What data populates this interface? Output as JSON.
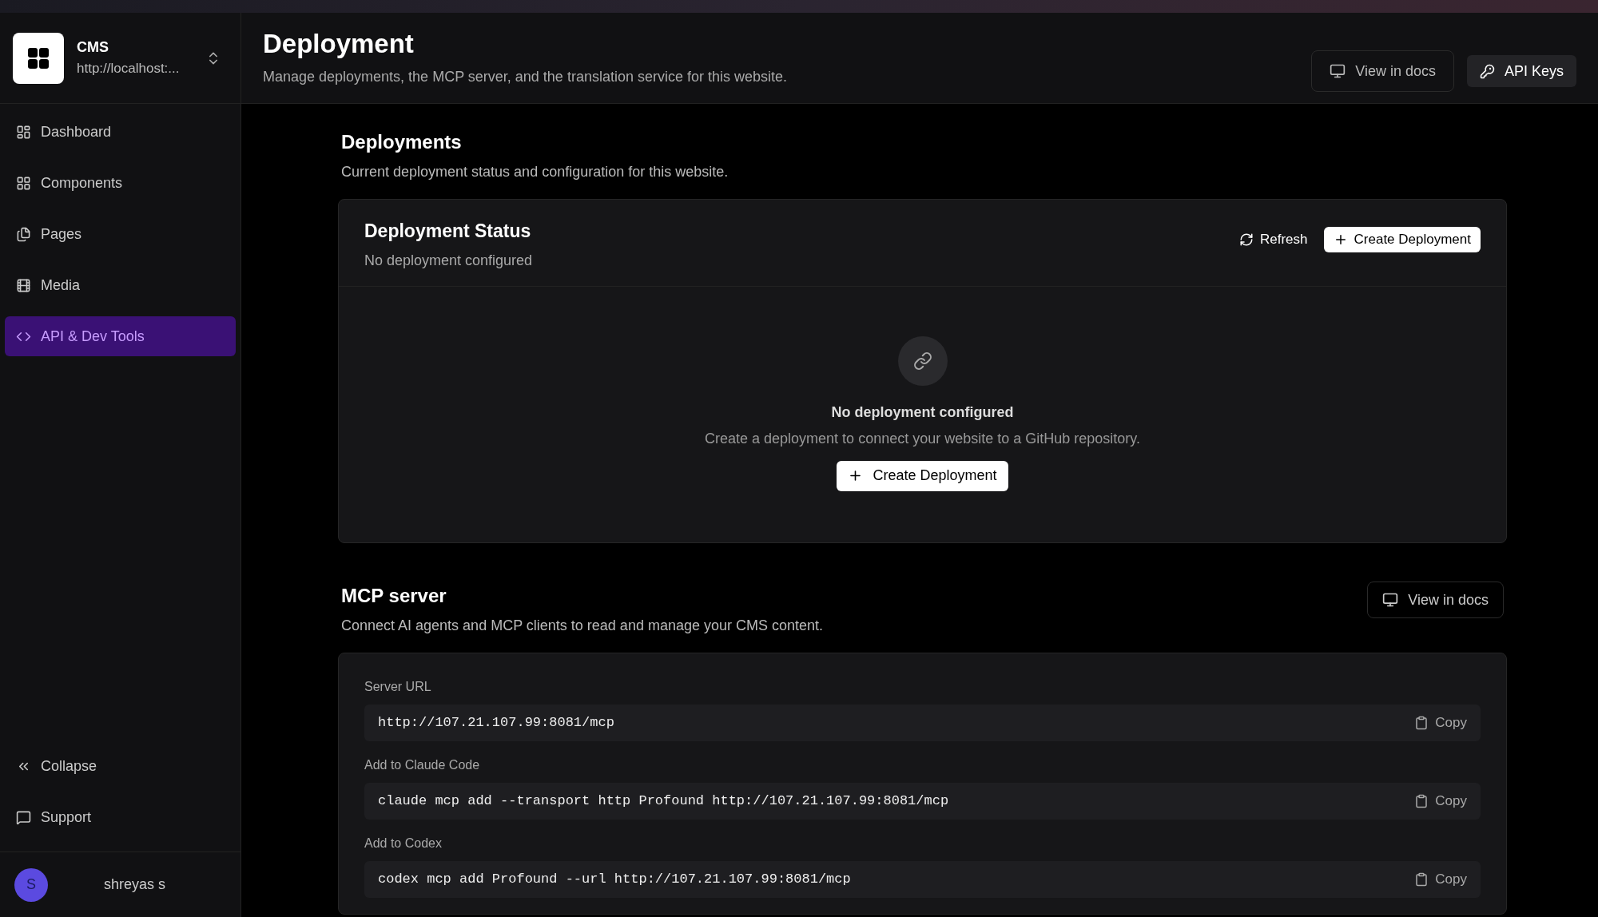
{
  "sidebar": {
    "workspace": {
      "name": "CMS",
      "url": "http://localhost:..."
    },
    "items": [
      {
        "label": "Dashboard",
        "selected": false
      },
      {
        "label": "Components",
        "selected": false
      },
      {
        "label": "Pages",
        "selected": false
      },
      {
        "label": "Media",
        "selected": false
      },
      {
        "label": "API & Dev Tools",
        "selected": true
      }
    ],
    "footer_items": [
      {
        "label": "Collapse"
      },
      {
        "label": "Support"
      }
    ],
    "user": {
      "initial": "S",
      "name": "shreyas s"
    }
  },
  "header": {
    "title": "Deployment",
    "subtitle": "Manage deployments, the MCP server, and the translation service for this website.",
    "docs_button": "View in docs",
    "keys_button": "API Keys"
  },
  "deployments": {
    "title": "Deployments",
    "subtitle": "Current deployment status and configuration for this website.",
    "card": {
      "title": "Deployment Status",
      "subtitle": "No deployment configured",
      "refresh_button": "Refresh",
      "create_button": "Create Deployment",
      "empty": {
        "title": "No deployment configured",
        "text": "Create a deployment to connect your website to a GitHub repository.",
        "button": "Create Deployment"
      }
    }
  },
  "mcp": {
    "title": "MCP server",
    "subtitle": "Connect AI agents and MCP clients to read and manage your CMS content.",
    "docs_button": "View in docs",
    "fields": [
      {
        "label": "Server URL",
        "value": "http://107.21.107.99:8081/mcp",
        "copy": "Copy"
      },
      {
        "label": "Add to Claude Code",
        "value": "claude mcp add --transport http Profound http://107.21.107.99:8081/mcp",
        "copy": "Copy"
      },
      {
        "label": "Add to Codex",
        "value": "codex mcp add Profound --url http://107.21.107.99:8081/mcp",
        "copy": "Copy"
      }
    ]
  }
}
